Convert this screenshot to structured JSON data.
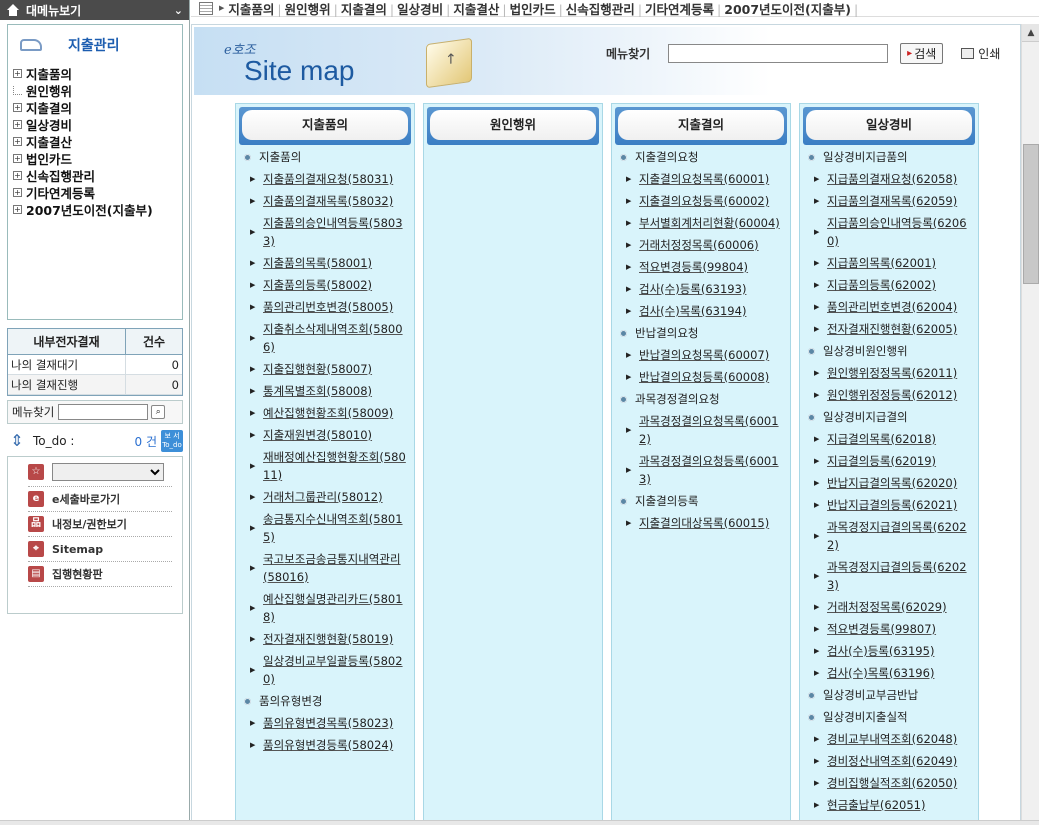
{
  "sidebar": {
    "header_label": "대메뉴보기",
    "tree_title": "지출관리",
    "tree": [
      {
        "label": "지출품의",
        "expand": "+"
      },
      {
        "label": "원인행위",
        "expand": ""
      },
      {
        "label": "지출결의",
        "expand": "+"
      },
      {
        "label": "일상경비",
        "expand": "+"
      },
      {
        "label": "지출결산",
        "expand": "+"
      },
      {
        "label": "법인카드",
        "expand": "+"
      },
      {
        "label": "신속집행관리",
        "expand": "+"
      },
      {
        "label": "기타연계등록",
        "expand": "+"
      },
      {
        "label": "2007년도이전(지출부)",
        "expand": "+"
      }
    ],
    "approval": {
      "header_col1": "내부전자결재",
      "header_col2": "건수",
      "rows": [
        {
          "label": "나의 결재대기",
          "count": "0"
        },
        {
          "label": "나의 결재진행",
          "count": "0"
        }
      ]
    },
    "menu_find_label": "메뉴찾기",
    "todo": {
      "label": "To_do :",
      "count": "0 건",
      "button": "보 서 To_do"
    },
    "quick_links": [
      {
        "label": "e세출바로가기",
        "icon": "e-icon"
      },
      {
        "label": "내정보/권한보기",
        "icon": "org-icon"
      },
      {
        "label": "Sitemap",
        "icon": "sitemap-icon"
      },
      {
        "label": "집행현황판",
        "icon": "board-icon"
      }
    ]
  },
  "topbar": {
    "items": [
      "지출품의",
      "원인행위",
      "지출결의",
      "일상경비",
      "지출결산",
      "법인카드",
      "신속집행관리",
      "기타연계등록",
      "2007년도이전(지출부)"
    ]
  },
  "banner": {
    "logo_small": "e호조",
    "logo_main": "Site map",
    "search_label": "메뉴찾기",
    "search_value": "",
    "search_button": "검색",
    "print_label": "인쇄"
  },
  "columns": [
    {
      "title": "지출품의",
      "items": [
        {
          "type": "group",
          "text": "지출품의"
        },
        {
          "type": "link",
          "text": "지출품의결재요청(58031)"
        },
        {
          "type": "link",
          "text": "지출품의결재목록(58032)"
        },
        {
          "type": "link",
          "text": "지출품의승인내역등록(58033)"
        },
        {
          "type": "link",
          "text": "지출품의목록(58001)"
        },
        {
          "type": "link",
          "text": "지출품의등록(58002)"
        },
        {
          "type": "link",
          "text": "품의관리번호변경(58005)"
        },
        {
          "type": "link",
          "text": "지출취소삭제내역조회(58006)"
        },
        {
          "type": "link",
          "text": "지출집행현황(58007)"
        },
        {
          "type": "link",
          "text": "통계목별조회(58008)"
        },
        {
          "type": "link",
          "text": "예산집행현황조회(58009)"
        },
        {
          "type": "link",
          "text": "지출재원변경(58010)"
        },
        {
          "type": "link",
          "text": "재배정예산집행현황조회(58011)"
        },
        {
          "type": "link",
          "text": "거래처그룹관리(58012)"
        },
        {
          "type": "link",
          "text": "송금통지수신내역조회(58015)"
        },
        {
          "type": "link",
          "text": "국고보조금송금통지내역관리(58016)"
        },
        {
          "type": "link",
          "text": "예산집행실명관리카드(58018)"
        },
        {
          "type": "link",
          "text": "전자결재진행현황(58019)"
        },
        {
          "type": "link",
          "text": "일상경비교부일괄등록(58020)"
        },
        {
          "type": "group",
          "text": "품의유형변경"
        },
        {
          "type": "link",
          "text": "품의유형변경목록(58023)"
        },
        {
          "type": "link",
          "text": "품의유형변경등록(58024)"
        }
      ]
    },
    {
      "title": "원인행위",
      "items": []
    },
    {
      "title": "지출결의",
      "items": [
        {
          "type": "group",
          "text": "지출결의요청"
        },
        {
          "type": "link",
          "text": "지출결의요청목록(60001)"
        },
        {
          "type": "link",
          "text": "지출결의요청등록(60002)"
        },
        {
          "type": "link",
          "text": "부서별회계처리현황(60004)"
        },
        {
          "type": "link",
          "text": "거래처정정목록(60006)"
        },
        {
          "type": "link",
          "text": "적요변경등록(99804)"
        },
        {
          "type": "link",
          "text": "검사(수)등록(63193)"
        },
        {
          "type": "link",
          "text": "검사(수)목록(63194)"
        },
        {
          "type": "group",
          "text": "반납결의요청"
        },
        {
          "type": "link",
          "text": "반납결의요청목록(60007)"
        },
        {
          "type": "link",
          "text": "반납결의요청등록(60008)"
        },
        {
          "type": "group",
          "text": "과목경정결의요청"
        },
        {
          "type": "link",
          "text": "과목경정결의요청목록(60012)"
        },
        {
          "type": "link",
          "text": "과목경정결의요청등록(60013)"
        },
        {
          "type": "group",
          "text": "지출결의등록"
        },
        {
          "type": "link",
          "text": "지출결의대상목록(60015)"
        }
      ]
    },
    {
      "title": "일상경비",
      "items": [
        {
          "type": "group",
          "text": "일상경비지급품의"
        },
        {
          "type": "link",
          "text": "지급품의결재요청(62058)"
        },
        {
          "type": "link",
          "text": "지급품의결재목록(62059)"
        },
        {
          "type": "link",
          "text": "지급품의승인내역등록(62060)"
        },
        {
          "type": "link",
          "text": "지급품의목록(62001)"
        },
        {
          "type": "link",
          "text": "지급품의등록(62002)"
        },
        {
          "type": "link",
          "text": "품의관리번호변경(62004)"
        },
        {
          "type": "link",
          "text": "전자결재진행현황(62005)"
        },
        {
          "type": "group",
          "text": "일상경비원인행위"
        },
        {
          "type": "link",
          "text": "원인행위정정목록(62011)"
        },
        {
          "type": "link",
          "text": "원인행위정정등록(62012)"
        },
        {
          "type": "group",
          "text": "일상경비지급결의"
        },
        {
          "type": "link",
          "text": "지급결의목록(62018)"
        },
        {
          "type": "link",
          "text": "지급결의등록(62019)"
        },
        {
          "type": "link",
          "text": "반납지급결의목록(62020)"
        },
        {
          "type": "link",
          "text": "반납지급결의등록(62021)"
        },
        {
          "type": "link",
          "text": "과목경정지급결의목록(62022)"
        },
        {
          "type": "link",
          "text": "과목경정지급결의등록(62023)"
        },
        {
          "type": "link",
          "text": "거래처정정목록(62029)"
        },
        {
          "type": "link",
          "text": "적요변경등록(99807)"
        },
        {
          "type": "link",
          "text": "검사(수)등록(63195)"
        },
        {
          "type": "link",
          "text": "검사(수)목록(63196)"
        },
        {
          "type": "group",
          "text": "일상경비교부금반납"
        },
        {
          "type": "group",
          "text": "일상경비지출실적"
        },
        {
          "type": "link",
          "text": "경비교부내역조회(62048)"
        },
        {
          "type": "link",
          "text": "경비정산내역조회(62049)"
        },
        {
          "type": "link",
          "text": "경비집행실적조회(62050)"
        },
        {
          "type": "link",
          "text": "현금출납부(62051)"
        }
      ]
    }
  ]
}
